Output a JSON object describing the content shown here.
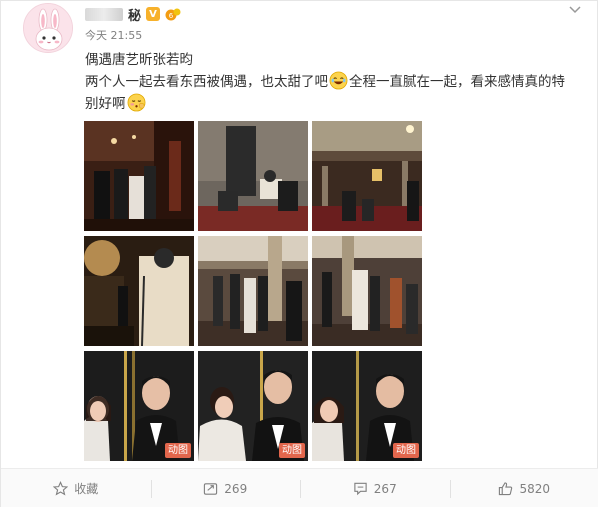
{
  "post": {
    "author": {
      "name_visible": "秘",
      "verified_badge": "V"
    },
    "time": "今天 21:55",
    "text_lines": [
      "偶遇唐艺昕张若昀",
      "两个人一起去看东西被偶遇，也太甜了吧",
      "全程一直腻在一起，看来感情真的特",
      "别好啊"
    ],
    "photos": [
      {
        "scene": "theater-entrance"
      },
      {
        "scene": "theater-seats-closeup"
      },
      {
        "scene": "theater-hall"
      },
      {
        "scene": "night-street"
      },
      {
        "scene": "crowd-walk-1"
      },
      {
        "scene": "crowd-walk-2"
      },
      {
        "scene": "couple-1",
        "badge": "动图"
      },
      {
        "scene": "couple-2",
        "badge": "动图"
      },
      {
        "scene": "couple-3",
        "badge": "动图"
      }
    ]
  },
  "actions": {
    "favorite_label": "收藏",
    "repost_count": "269",
    "comment_count": "267",
    "like_count": "5820"
  },
  "icons": [
    "rabbit-avatar",
    "verified-v-icon",
    "level-icon",
    "chevron-down-icon",
    "laugh-emoji",
    "shy-emoji",
    "star-icon",
    "repost-icon",
    "comment-icon",
    "like-icon"
  ]
}
